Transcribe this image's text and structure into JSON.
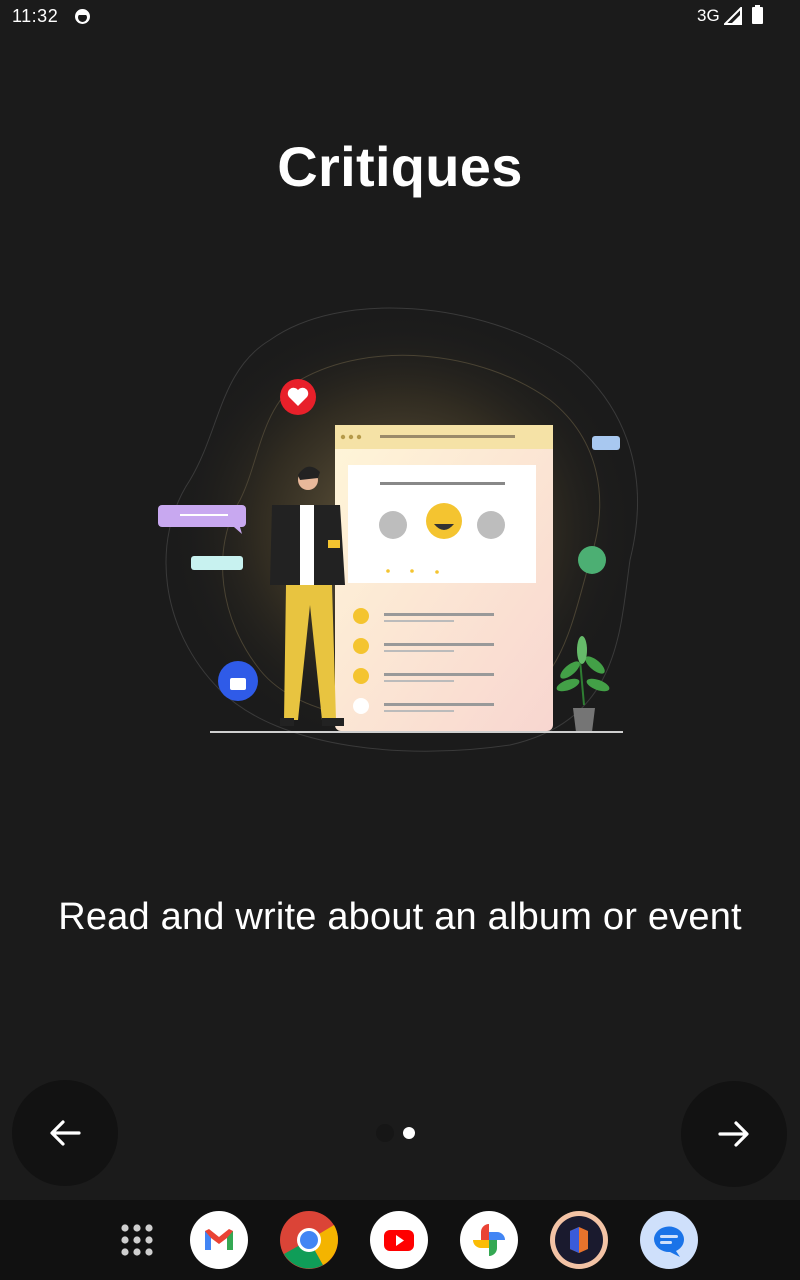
{
  "status_bar": {
    "time": "11:32",
    "network": "3G",
    "icons": [
      "notification-icon",
      "signal-icon",
      "battery-icon"
    ]
  },
  "title": "Critiques",
  "subtitle": "Read and write about an album or event",
  "pager": {
    "total": 2,
    "current": 1
  },
  "navigation": {
    "prev_icon": "arrow-left-icon",
    "next_icon": "arrow-right-icon"
  },
  "dock": {
    "apps": [
      "app-drawer-icon",
      "gmail-icon",
      "chrome-icon",
      "youtube-icon",
      "photos-icon",
      "app-icon",
      "messages-icon"
    ]
  },
  "colors": {
    "background": "#1b1b1b",
    "text": "#ffffff",
    "accent_yellow": "#f4c430",
    "heart_red": "#e8202a",
    "thumb_blue": "#2f5be8"
  }
}
